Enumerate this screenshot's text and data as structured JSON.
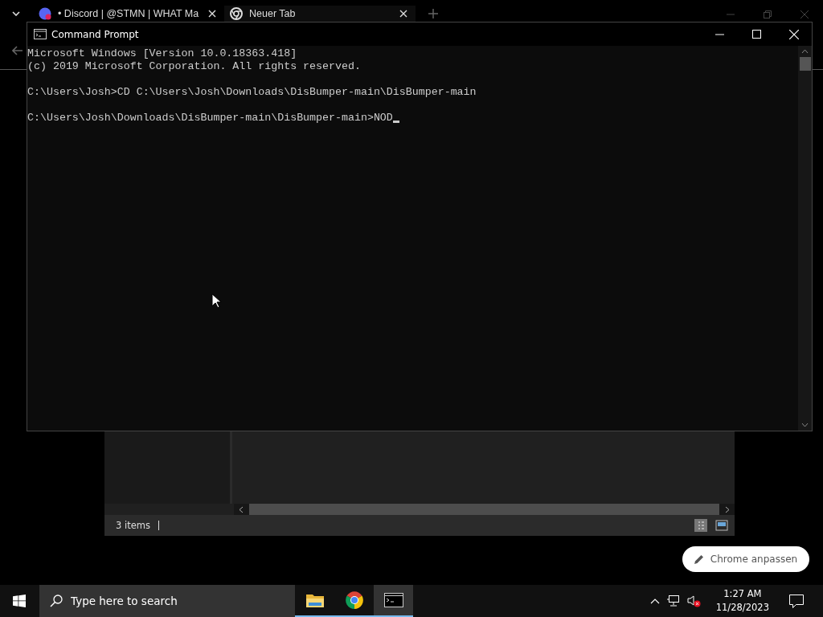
{
  "browser": {
    "tabs": [
      {
        "title": "• Discord | @STMN | WHAT Ma",
        "selected": false
      },
      {
        "title": "Neuer Tab",
        "selected": true
      }
    ],
    "customize_button": "Chrome anpassen"
  },
  "explorer": {
    "status": "3 items"
  },
  "console": {
    "title": "Command Prompt",
    "blocks": [
      [
        "Microsoft Windows [Version 10.0.18363.418]",
        "(c) 2019 Microsoft Corporation. All rights reserved."
      ],
      [
        "C:\\Users\\Josh>CD C:\\Users\\Josh\\Downloads\\DisBumper-main\\DisBumper-main"
      ]
    ],
    "prompt": "C:\\Users\\Josh\\Downloads\\DisBumper-main\\DisBumper-main>",
    "input": "NOD"
  },
  "taskbar": {
    "search_placeholder": "Type here to search",
    "apps": [
      {
        "kind": "folder",
        "active": false
      },
      {
        "kind": "chrome",
        "active": false
      },
      {
        "kind": "terminal",
        "active": true
      }
    ],
    "time": "1:27 AM",
    "date": "11/28/2023"
  }
}
